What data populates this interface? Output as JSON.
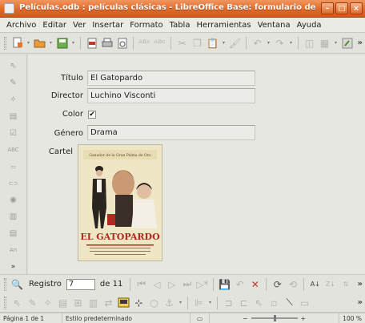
{
  "window": {
    "title": "Películas.odb : películas clásicas - LibreOffice Base: formulario de base de datos",
    "buttons": {
      "minimize": "–",
      "maximize": "□",
      "close": "×"
    }
  },
  "menubar": {
    "items": [
      "Archivo",
      "Editar",
      "Ver",
      "Insertar",
      "Formato",
      "Tabla",
      "Herramientas",
      "Ventana",
      "Ayuda"
    ]
  },
  "form": {
    "fields": [
      {
        "label": "Título",
        "value": "El Gatopardo"
      },
      {
        "label": "Director",
        "value": "Luchino Visconti"
      },
      {
        "label": "Género",
        "value": "Drama"
      }
    ],
    "color_label": "Color",
    "color_checked": "✔",
    "poster_label": "Cartel",
    "poster": {
      "tagline": "Ganador de la Gran Palma de Oro",
      "title": "EL GATOPARDO",
      "colors": {
        "background": "#efe6c6",
        "title": "#b0291e",
        "figure": "#2a2420"
      }
    }
  },
  "navigation": {
    "record_label": "Registro",
    "current_record": "7",
    "of_label": "de 11"
  },
  "statusbar": {
    "page": "Página 1 de 1",
    "style": "Estilo predeterminado",
    "zoom": "100 %"
  },
  "icons": {
    "toolbar1": [
      "new-doc-icon",
      "open-folder-icon",
      "save-icon",
      "export-pdf-icon",
      "print-icon",
      "print-preview-icon",
      "spellcheck-icon",
      "autospell-icon",
      "cut-icon",
      "copy-icon",
      "paste-icon",
      "clone-format-icon",
      "undo-icon",
      "redo-icon",
      "navigator-icon",
      "table-icon",
      "form-design-icon"
    ],
    "lefttools": [
      "select-icon",
      "design-mode-icon",
      "control-wizards-icon",
      "form-navigator-icon",
      "checkbox-tool-icon",
      "label-tool-icon",
      "textbox-tool-icon",
      "button-tool-icon",
      "radio-tool-icon",
      "listbox-tool-icon",
      "combobox-tool-icon",
      "text-tool-icon",
      "more-controls-icon"
    ]
  }
}
